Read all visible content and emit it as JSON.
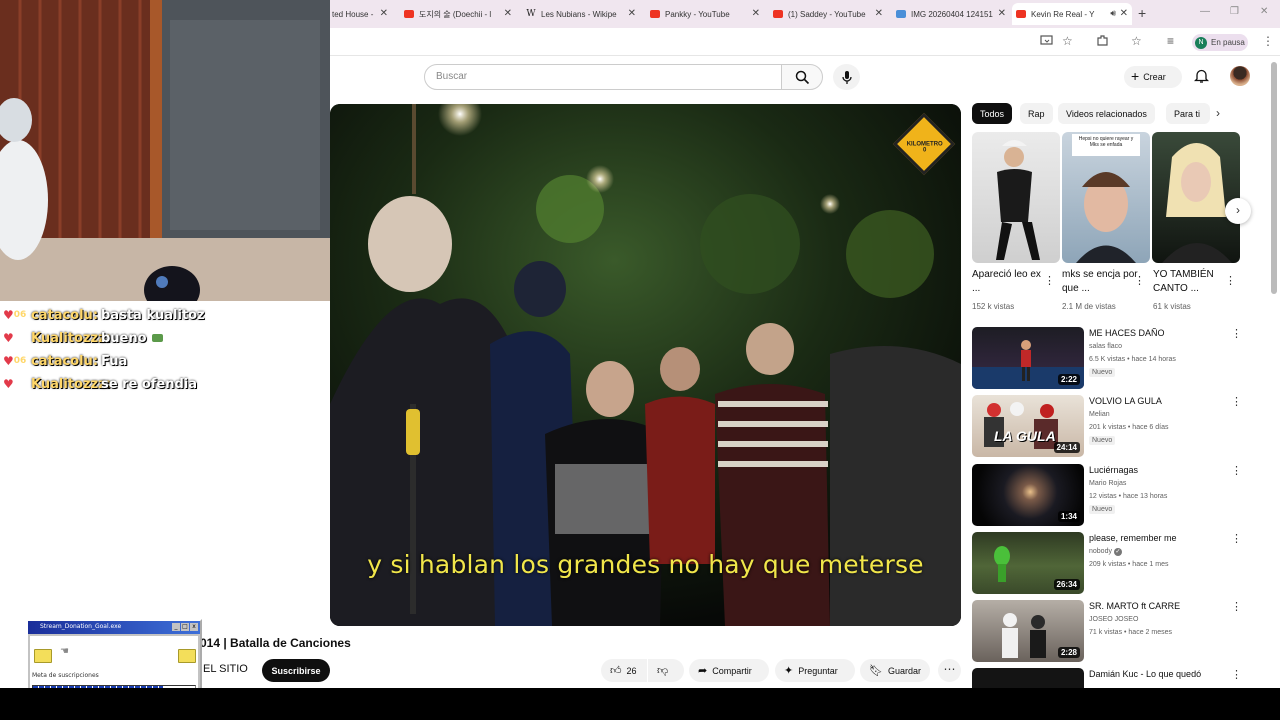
{
  "browser": {
    "tabs": [
      {
        "title": "ted House - ",
        "favicon": "none",
        "active": false
      },
      {
        "title": "도지의 술 (Doechii - l",
        "favicon": "youtube-icon",
        "active": false
      },
      {
        "title": "Les Nubians - Wikipe",
        "favicon": "wikipedia-icon",
        "active": false
      },
      {
        "title": "Pankky - YouTube",
        "favicon": "youtube-icon",
        "active": false
      },
      {
        "title": "(1) Saddey - YouTube",
        "favicon": "youtube-icon",
        "active": false
      },
      {
        "title": "IMG 20260404 124151",
        "favicon": "image-icon",
        "active": false
      },
      {
        "title": "Kevin Re Real - Y",
        "favicon": "youtube-icon",
        "active": true
      }
    ],
    "profile_status": "En pausa",
    "profile_initial": "N"
  },
  "youtube": {
    "search_placeholder": "Buscar",
    "create_label": "Crear"
  },
  "video": {
    "subtitle": "y si hablan los grandes no hay que meterse",
    "title": "014 | Batalla de Canciones",
    "channel": "EL SITIO",
    "subscribe_label": "Suscribirse",
    "likes": "26",
    "share_label": "Compartir",
    "ask_label": "Preguntar",
    "save_label": "Guardar",
    "badge_text": "KILOMETRO 0"
  },
  "chips": [
    "Todos",
    "Rap",
    "Videos relacionados",
    "Para ti"
  ],
  "shorts": [
    {
      "title": "Apareció leo ex ...",
      "views": "152 k vistas"
    },
    {
      "title": "mks se encja por que ...",
      "views": "2.1 M de vistas",
      "thumb_text": "Hepsi no quiere rayear y Mks se enfada"
    },
    {
      "title": "YO TAMBIÉN CANTO ...",
      "views": "61 k vistas"
    }
  ],
  "recommendations": [
    {
      "title": "ME HACES DAÑO",
      "channel": "salas flaco",
      "meta": "6.5 K vistas • hace 14 horas",
      "badge": "Nuevo",
      "duration": "2:22"
    },
    {
      "title": "VOLVIO LA GULA",
      "channel": "Melian",
      "meta": "201 k vistas • hace 6 días",
      "badge": "Nuevo",
      "duration": "24:14",
      "thumb_text": "LA GULA"
    },
    {
      "title": "Luciérnagas",
      "channel": "Mario Rojas",
      "meta": "12 vistas • hace 13 horas",
      "badge": "Nuevo",
      "duration": "1:34"
    },
    {
      "title": "please, remember me",
      "channel": "nobody",
      "meta": "209 k vistas • hace 1 mes",
      "badge": "",
      "duration": "26:34"
    },
    {
      "title": "SR. MARTO ft CARRE",
      "channel": "JOSEO JOSEO",
      "meta": "71 k vistas • hace 2 meses",
      "badge": "",
      "duration": "2:28"
    },
    {
      "title": "Damián Kuc - Lo que quedó",
      "channel": "",
      "meta": "",
      "badge": "",
      "duration": ""
    }
  ],
  "chat": [
    {
      "badge": "06",
      "user": "catacolu:",
      "message": "basta kualitoz"
    },
    {
      "badge": "",
      "user": "Kualitozzz:",
      "message": "bueno"
    },
    {
      "badge": "06",
      "user": "catacolu:",
      "message": "Fua"
    },
    {
      "badge": "",
      "user": "Kualitozzz:",
      "message": "se re ofendia"
    }
  ],
  "donation_window": {
    "title": "Stream_Donation_Goal.exe",
    "label": "Meta de suscripciones",
    "progress": 0.8
  }
}
